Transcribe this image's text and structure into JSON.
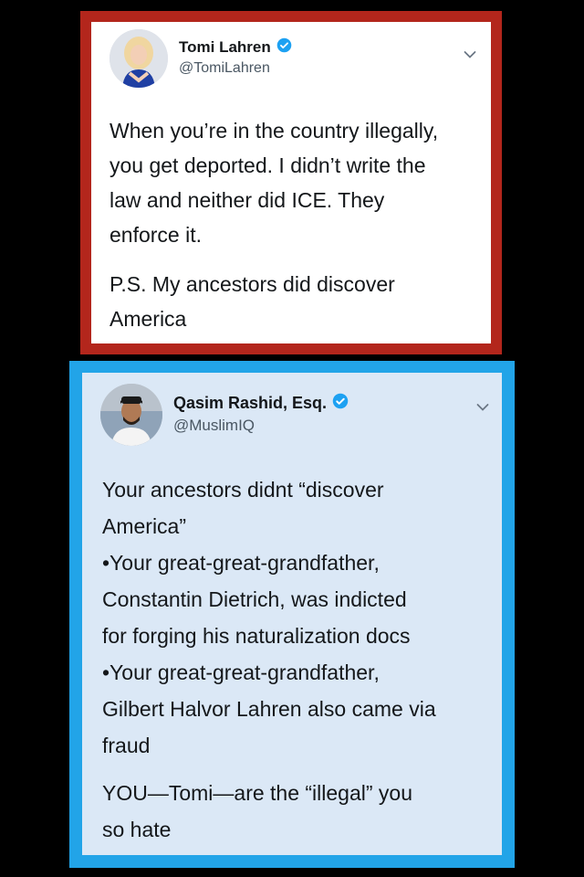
{
  "colors": {
    "top_frame": "#b3261c",
    "bottom_frame": "#22a4e8",
    "verified_badge": "#1da1f2",
    "bottom_card_bg": "#dbe8f6"
  },
  "tweet1": {
    "avatar_icon": "profile-photo-woman",
    "name": "Tomi Lahren",
    "handle": "@TomiLahren",
    "body_lines": [
      "When you’re in the country illegally,",
      "you get deported. I didn’t write the",
      "law and neither did ICE. They",
      "enforce it."
    ],
    "ps_lines": [
      "P.S. My ancestors did discover",
      "America"
    ]
  },
  "tweet2": {
    "avatar_icon": "profile-photo-man",
    "name": "Qasim Rashid, Esq.",
    "handle": "@MuslimIQ",
    "lines": [
      "Your ancestors didnt “discover",
      "America”",
      "•Your great-great-grandfather,",
      "Constantin Dietrich, was indicted",
      "for forging his naturalization docs",
      "•Your great-great-grandfather,",
      "Gilbert Halvor Lahren also came via",
      "fraud"
    ],
    "closing_lines": [
      "YOU—Tomi—are the “illegal” you",
      "so hate"
    ]
  }
}
